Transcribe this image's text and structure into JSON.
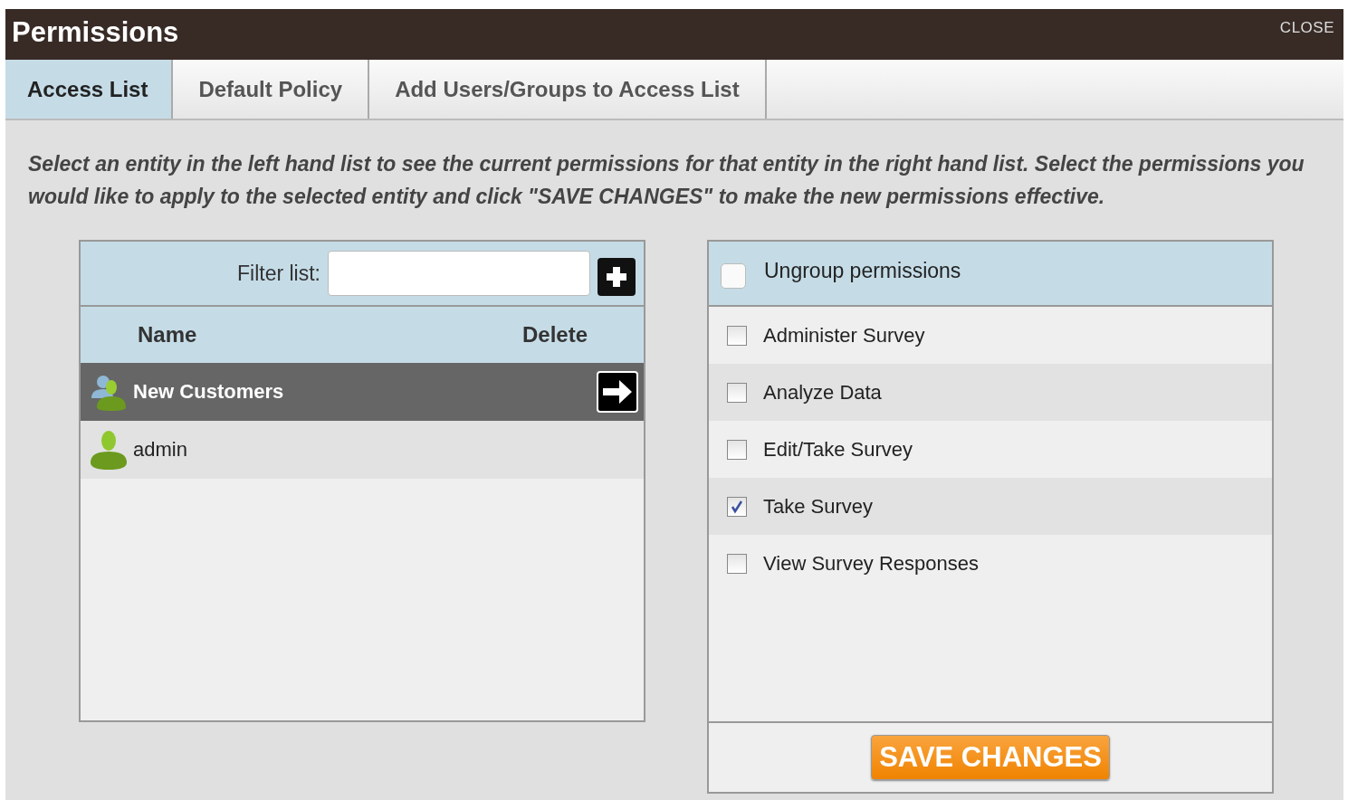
{
  "window": {
    "title": "Permissions",
    "close": "CLOSE"
  },
  "tabs": [
    {
      "label": "Access List",
      "selected": true
    },
    {
      "label": "Default Policy",
      "selected": false
    },
    {
      "label": "Add Users/Groups to Access List",
      "selected": false
    }
  ],
  "instructions": "Select an entity in the left hand list to see the current permissions for that entity in the right hand list. Select the permissions you would like to apply to the selected entity and click \"SAVE CHANGES\" to make the new permissions effective.",
  "access_list": {
    "filter_label": "Filter list:",
    "columns": [
      "Name",
      "Delete"
    ],
    "rows": [
      {
        "name": "New Customers",
        "kind": "group",
        "selected": true
      },
      {
        "name": "admin",
        "kind": "user",
        "selected": false
      }
    ]
  },
  "permissions": {
    "ungroup": {
      "label": "Ungroup permissions",
      "checked": false
    },
    "items": [
      {
        "label": "Administer Survey",
        "checked": false
      },
      {
        "label": "Analyze Data",
        "checked": false
      },
      {
        "label": "Edit/Take Survey",
        "checked": false
      },
      {
        "label": "Take Survey",
        "checked": true
      },
      {
        "label": "View Survey Responses",
        "checked": false
      }
    ],
    "save": "SAVE CHANGES"
  }
}
